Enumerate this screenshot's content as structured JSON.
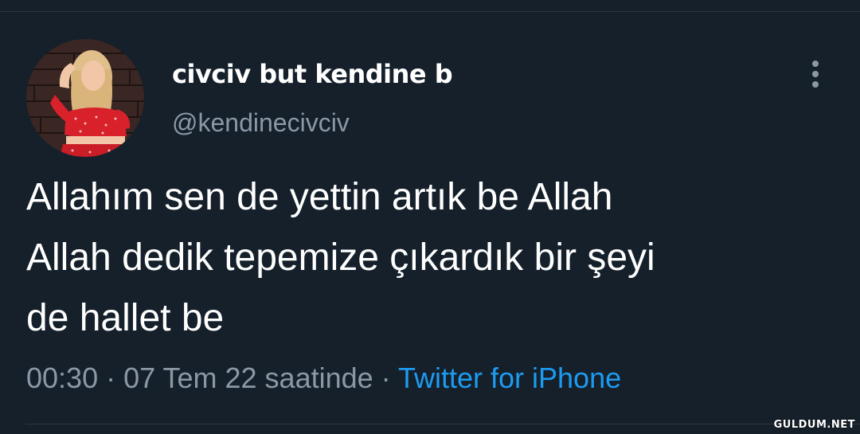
{
  "author": {
    "display_name": "civciv but kendine b",
    "handle": "@kendinecivciv",
    "avatar_icon": "profile-photo"
  },
  "tweet": {
    "text": "Allahım sen de yettin artık be Allah\nAllah dedik tepemize çıkardık bir şeyi\nde hallet be",
    "time": "00:30",
    "separator": " · ",
    "date": "07 Tem 22 saatinde",
    "source": "Twitter for iPhone"
  },
  "more_icon": "more-vertical-icon",
  "watermark": "GULDUM.NET",
  "colors": {
    "background": "#15202b",
    "text": "#ffffff",
    "secondary": "#8b98a5",
    "link": "#1d9bf0"
  }
}
